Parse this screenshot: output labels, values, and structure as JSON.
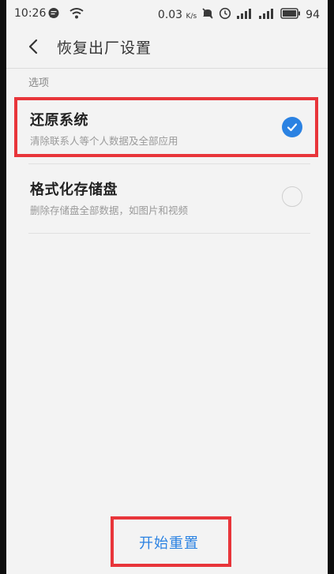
{
  "status_bar": {
    "time": "10:26",
    "speed_value": "0.03",
    "speed_unit": "K/s",
    "battery": "94"
  },
  "header": {
    "title": "恢复出厂设置"
  },
  "section": {
    "label": "选项"
  },
  "options": [
    {
      "title": "还原系统",
      "subtitle": "清除联系人等个人数据及全部应用",
      "selected": true
    },
    {
      "title": "格式化存储盘",
      "subtitle": "删除存储盘全部数据，如图片和视频",
      "selected": false
    }
  ],
  "action": {
    "reset_label": "开始重置"
  },
  "colors": {
    "accent": "#2b82e2",
    "highlight": "#e8353a"
  },
  "icons": [
    "back-arrow-icon",
    "check-icon",
    "wifi-icon",
    "message-icon",
    "mute-icon",
    "alarm-icon",
    "signal-icon",
    "battery-icon"
  ]
}
